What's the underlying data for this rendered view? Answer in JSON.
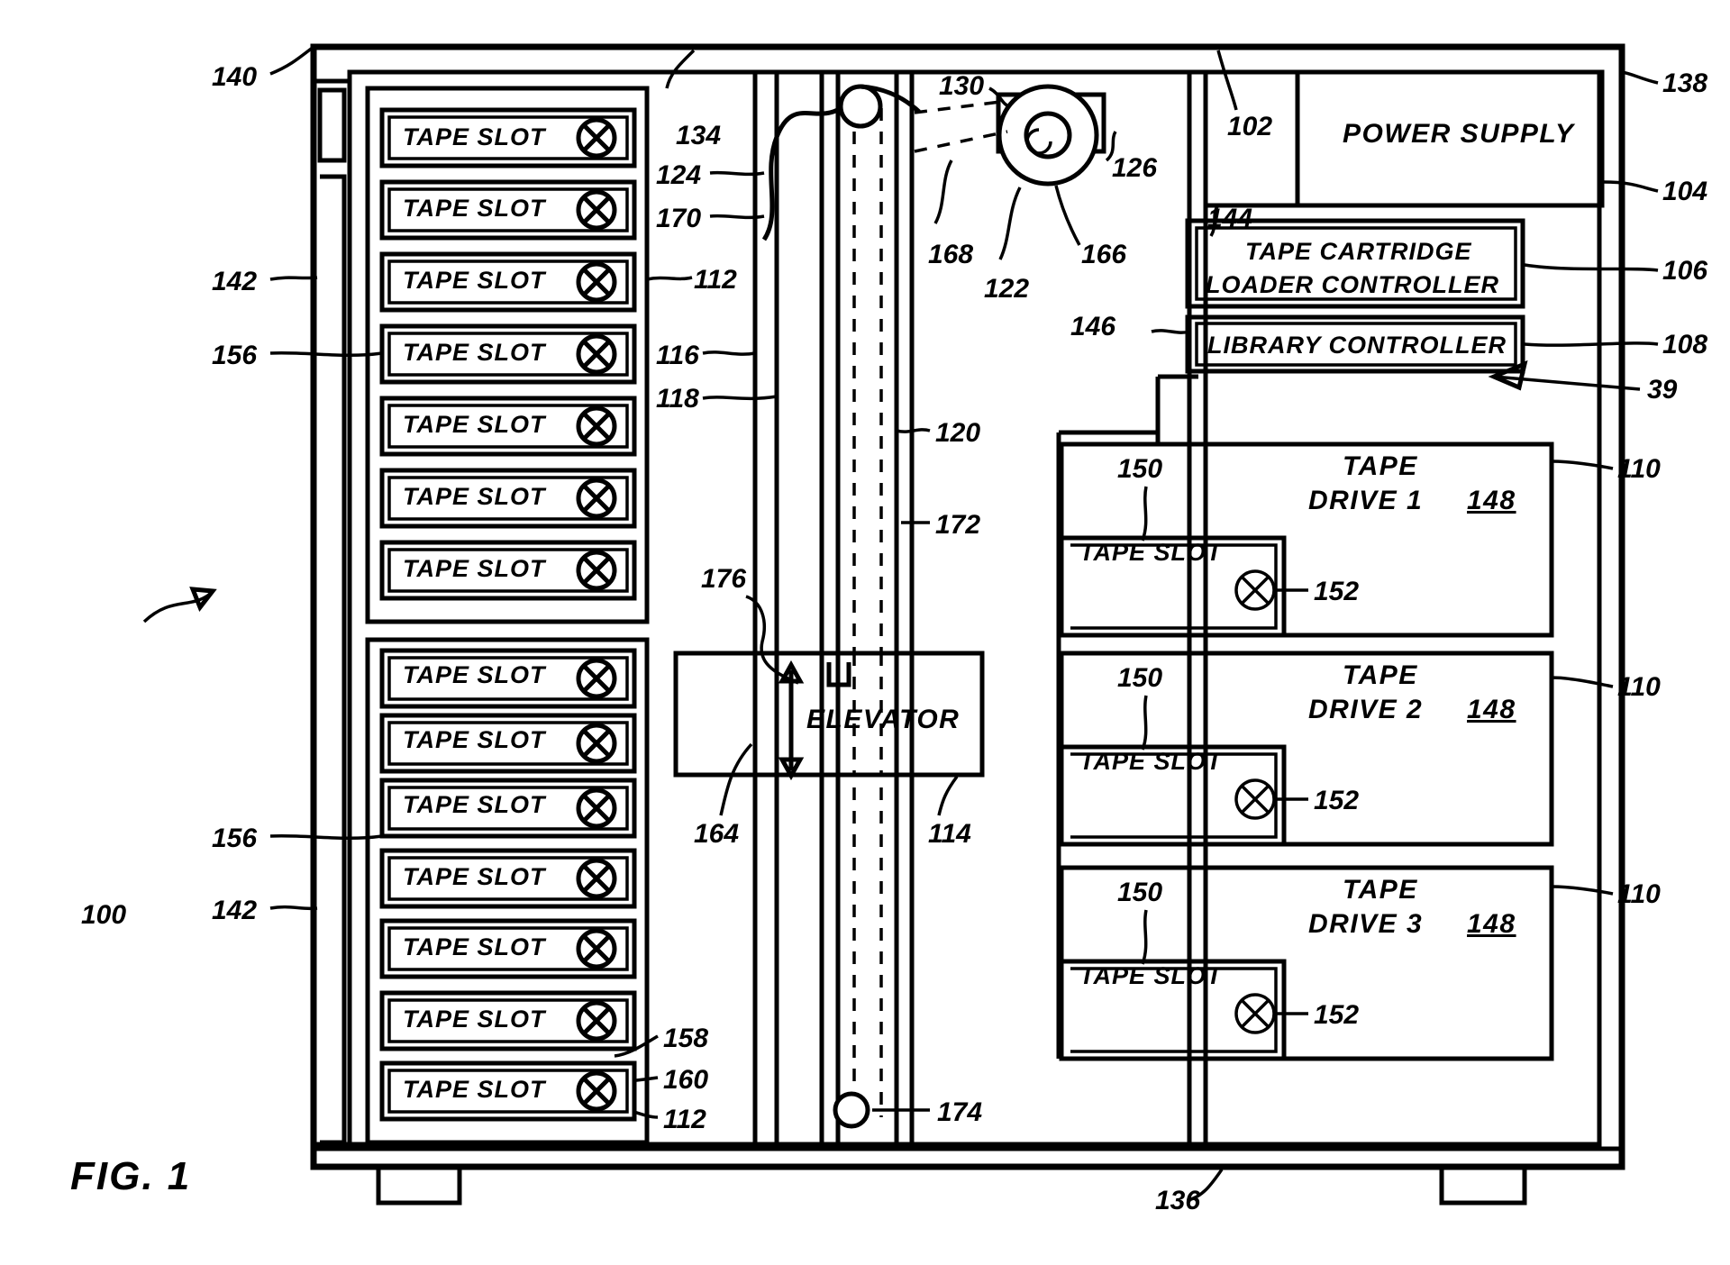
{
  "figure": {
    "caption": "FIG. 1",
    "system_ref": "100"
  },
  "slots": {
    "label": "TAPE SLOT",
    "upper_bank_count": 7,
    "lower_bank_count": 7
  },
  "blocks": {
    "power_supply": "POWER SUPPLY",
    "tape_cartridge_loader_controller_line1": "TAPE CARTRIDGE",
    "tape_cartridge_loader_controller_line2": "LOADER CONTROLLER",
    "library_controller": "LIBRARY CONTROLLER",
    "elevator": "ELEVATOR"
  },
  "drives": [
    {
      "name_line1": "TAPE",
      "name_line2": "DRIVE 1",
      "num": "148",
      "slot_label": "TAPE SLOT",
      "slot_ref": "150",
      "icon_ref": "152",
      "drive_ref": "110"
    },
    {
      "name_line1": "TAPE",
      "name_line2": "DRIVE 2",
      "num": "148",
      "slot_label": "TAPE SLOT",
      "slot_ref": "150",
      "icon_ref": "152",
      "drive_ref": "110"
    },
    {
      "name_line1": "TAPE",
      "name_line2": "DRIVE 3",
      "num": "148",
      "slot_label": "TAPE SLOT",
      "slot_ref": "150",
      "icon_ref": "152",
      "drive_ref": "110"
    }
  ],
  "refs": {
    "r100": "100",
    "r102": "102",
    "r104": "104",
    "r106": "106",
    "r108": "108",
    "r110a": "110",
    "r110b": "110",
    "r110c": "110",
    "r112a": "112",
    "r112b": "112",
    "r114": "114",
    "r116": "116",
    "r118": "118",
    "r120": "120",
    "r122": "122",
    "r124": "124",
    "r126": "126",
    "r130": "130",
    "r134": "134",
    "r136": "136",
    "r138": "138",
    "r140": "140",
    "r142a": "142",
    "r142b": "142",
    "r144": "144",
    "r146": "146",
    "r148a": "148",
    "r148b": "148",
    "r148c": "148",
    "r150a": "150",
    "r150b": "150",
    "r150c": "150",
    "r152a": "152",
    "r152b": "152",
    "r152c": "152",
    "r156a": "156",
    "r156b": "156",
    "r158": "158",
    "r160": "160",
    "r164": "164",
    "r166": "166",
    "r168": "168",
    "r170": "170",
    "r172": "172",
    "r174": "174",
    "r176": "176",
    "r39": "39"
  },
  "colors": {
    "ink": "#000000",
    "paper": "#ffffff"
  }
}
